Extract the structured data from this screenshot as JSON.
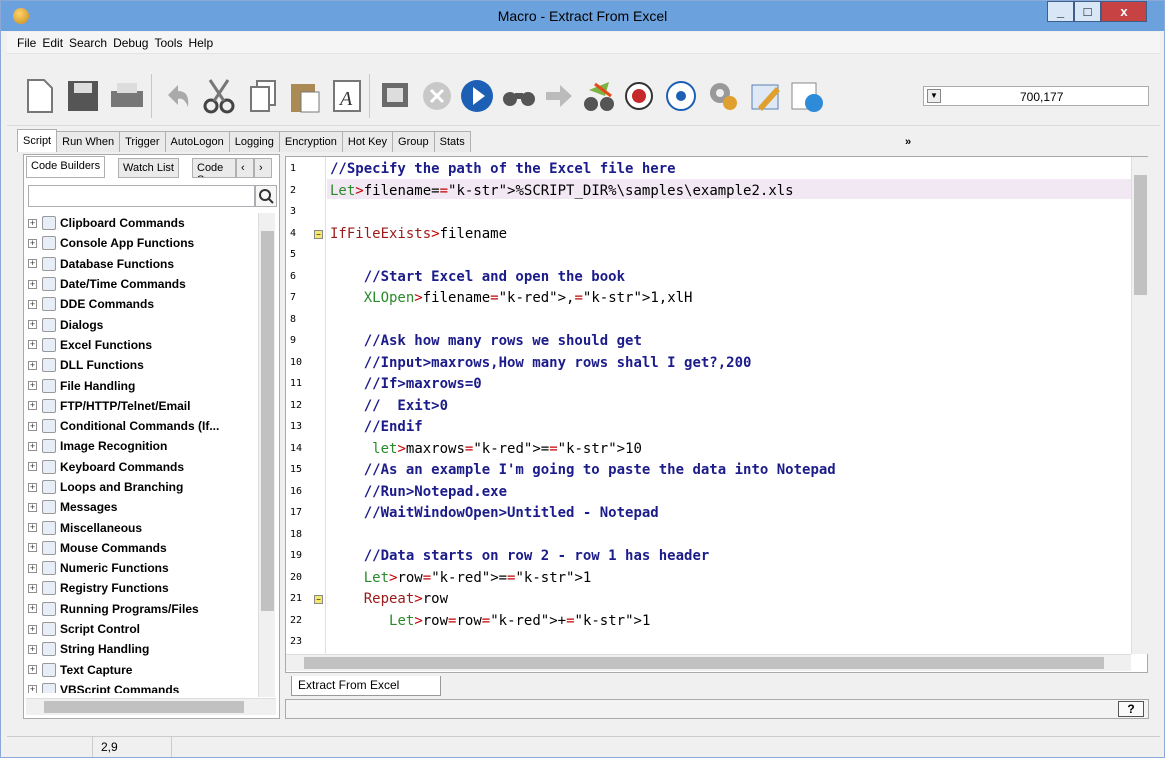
{
  "window": {
    "title": "Macro - Extract From Excel",
    "min": "_",
    "max": "□",
    "close": "x"
  },
  "menu": [
    "File",
    "Edit",
    "Search",
    "Debug",
    "Tools",
    "Help"
  ],
  "toolbar": {
    "overflow": "»",
    "combo_value": "700,177"
  },
  "tabs": [
    "Script",
    "Run When",
    "Trigger",
    "AutoLogon",
    "Logging",
    "Encryption",
    "Hot Key",
    "Group",
    "Stats"
  ],
  "left_tabs": [
    "Code Builders",
    "Watch List",
    "Code S"
  ],
  "tree": [
    "Clipboard Commands",
    "Console App Functions",
    "Database Functions",
    "Date/Time Commands",
    "DDE Commands",
    "Dialogs",
    "Excel Functions",
    "DLL Functions",
    "File Handling",
    "FTP/HTTP/Telnet/Email",
    "Conditional Commands (If...",
    "Image Recognition",
    "Keyboard Commands",
    "Loops and Branching",
    "Messages",
    "Miscellaneous",
    "Mouse Commands",
    "Numeric Functions",
    "Registry Functions",
    "Running Programs/Files",
    "Script Control",
    "String Handling",
    "Text Capture",
    "VBScript Commands"
  ],
  "code": [
    "//Specify the path of the Excel file here",
    "Let>filename=%SCRIPT_DIR%\\samples\\example2.xls",
    "",
    "IfFileExists>filename",
    "",
    "    //Start Excel and open the book",
    "    XLOpen>filename,1,xlH",
    "",
    "    //Ask how many rows we should get",
    "    //Input>maxrows,How many rows shall I get?,200",
    "    //If>maxrows=0",
    "    //  Exit>0",
    "    //Endif",
    "     let>maxrows=10",
    "    //As an example I'm going to paste the data into Notepad",
    "    //Run>Notepad.exe",
    "    //WaitWindowOpen>Untitled - Notepad",
    "",
    "    //Data starts on row 2 - row 1 has header",
    "    Let>row=1",
    "    Repeat>row",
    "       Let>row=row+1",
    ""
  ],
  "doc_tab": "Extract From Excel",
  "help": "?",
  "status": {
    "position": "2,9"
  }
}
